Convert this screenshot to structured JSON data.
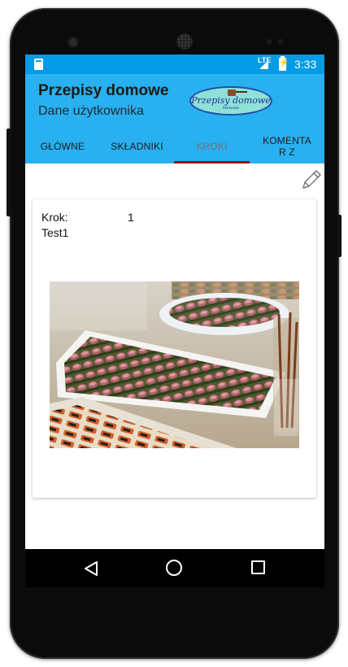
{
  "status_bar": {
    "network": "LTE",
    "time": "3:33"
  },
  "app_bar": {
    "title": "Przepisy domowe",
    "subtitle": "Dane użytkownika",
    "logo": {
      "text": "Przepisy domowe",
      "subtext": "Melanie"
    }
  },
  "tabs": [
    {
      "label": "GŁÓWNE",
      "active": false
    },
    {
      "label": "SKŁADNIKI",
      "active": false
    },
    {
      "label": "KROKI",
      "active": true
    },
    {
      "label": "KOMENTAR Z",
      "active": false
    }
  ],
  "content": {
    "edit_icon": "pencil-icon",
    "step_card": {
      "step_label": "Krok:",
      "step_number": "1",
      "step_text": "Test1"
    }
  },
  "colors": {
    "status_bar": "#039be5",
    "app_bar": "#29b0f0",
    "tab_indicator": "#8b1a1a",
    "nav_bar": "#000000"
  },
  "nav_bar": {
    "back_icon": "back-triangle-icon",
    "home_icon": "home-circle-icon",
    "recent_icon": "recent-square-icon"
  }
}
